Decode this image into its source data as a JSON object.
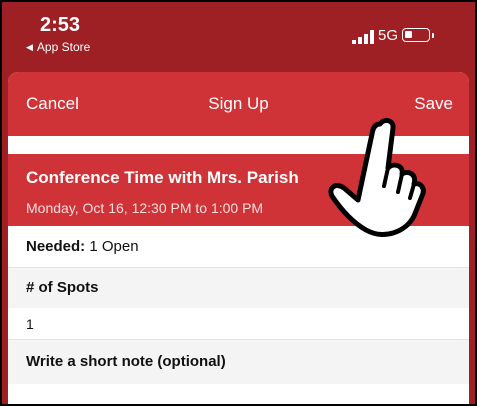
{
  "status_bar": {
    "time": "2:53",
    "back_app": "App Store",
    "network": "5G"
  },
  "navbar": {
    "cancel_label": "Cancel",
    "title": "Sign Up",
    "save_label": "Save"
  },
  "event": {
    "title": "Conference Time with Mrs. Parish",
    "time": "Monday, Oct 16, 12:30 PM to 1:00 PM"
  },
  "needed": {
    "label": "Needed:",
    "value": "1 Open"
  },
  "spots": {
    "label": "# of Spots",
    "value": "1"
  },
  "note": {
    "label": "Write a short note (optional)",
    "value": ""
  },
  "colors": {
    "status_bar_bg": "#9e1f24",
    "accent_red": "#cf3237"
  },
  "overlay": {
    "icon": "pointing-hand-icon"
  }
}
